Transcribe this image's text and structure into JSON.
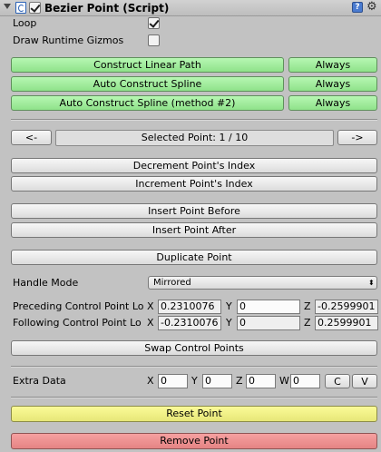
{
  "header": {
    "title": "Bezier Point (Script)",
    "help_glyph": "?",
    "gear_glyph": "⚙"
  },
  "toggles": {
    "loop_label": "Loop",
    "loop_checked": true,
    "gizmos_label": "Draw Runtime Gizmos",
    "gizmos_checked": false
  },
  "construct": {
    "linear": "Construct Linear Path",
    "auto": "Auto Construct Spline",
    "auto2": "Auto Construct Spline (method #2)",
    "always": "Always"
  },
  "navigation": {
    "prev": "<-",
    "next": "->",
    "selected": "Selected Point: 1 / 10"
  },
  "index": {
    "decrement": "Decrement Point's Index",
    "increment": "Increment Point's Index"
  },
  "insert": {
    "before": "Insert Point Before",
    "after": "Insert Point After"
  },
  "duplicate": "Duplicate Point",
  "handle": {
    "label": "Handle Mode",
    "value": "Mirrored",
    "arrow": "⬍"
  },
  "preceding": {
    "label": "Preceding Control Point Lo",
    "x": "0.2310076",
    "y": "0",
    "z": "-0.2599901"
  },
  "following": {
    "label": "Following Control Point Lo",
    "x": "-0.2310076",
    "y": "0",
    "z": "0.2599901"
  },
  "swap": "Swap Control Points",
  "extra": {
    "label": "Extra Data",
    "x": "0",
    "y": "0",
    "z": "0",
    "w": "0",
    "c": "C",
    "v": "V"
  },
  "axes": {
    "x": "X",
    "y": "Y",
    "z": "Z",
    "w": "W"
  },
  "reset": "Reset Point",
  "remove": "Remove Point",
  "colors": {
    "green": "#9eee99",
    "yellow": "#f3f388",
    "red": "#ee9191",
    "background": "#c2c2c2"
  }
}
